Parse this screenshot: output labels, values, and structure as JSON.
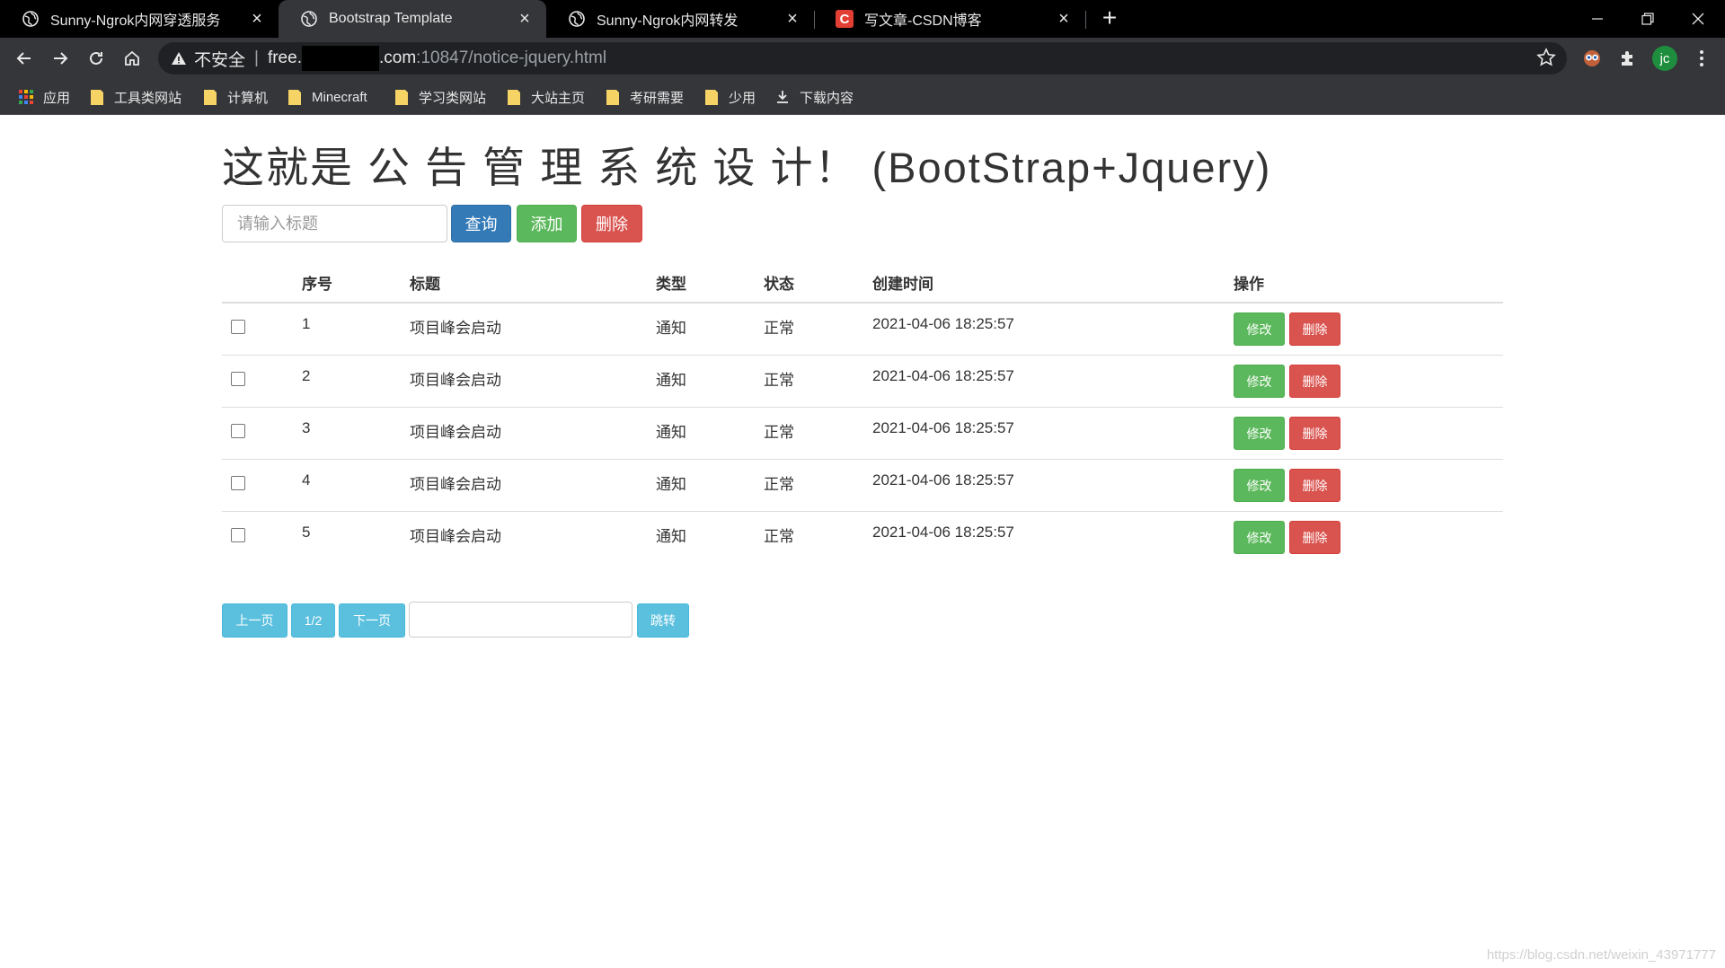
{
  "browser": {
    "tabs": [
      {
        "title": "Sunny-Ngrok内网穿透服务",
        "icon": "globe-icon",
        "active": false
      },
      {
        "title": "Bootstrap Template",
        "icon": "globe-icon",
        "active": true
      },
      {
        "title": "Sunny-Ngrok内网转发",
        "icon": "globe-icon",
        "active": false
      },
      {
        "title": "写文章-CSDN博客",
        "icon": "csdn-icon",
        "active": false
      }
    ],
    "address": {
      "security_label": "不安全",
      "host_prefix": "free.",
      "host_suffix": ".com",
      "path": ":10847/notice-jquery.html"
    },
    "profile_initials": "jc",
    "bookmarks": [
      {
        "label": "应用",
        "icon": "apps-grid-icon"
      },
      {
        "label": "工具类网站",
        "icon": "folder-icon"
      },
      {
        "label": "计算机",
        "icon": "folder-icon"
      },
      {
        "label": "Minecraft",
        "icon": "folder-icon"
      },
      {
        "label": "学习类网站",
        "icon": "folder-icon"
      },
      {
        "label": "大站主页",
        "icon": "folder-icon"
      },
      {
        "label": "考研需要",
        "icon": "folder-icon"
      },
      {
        "label": "少用",
        "icon": "folder-icon"
      },
      {
        "label": "下载内容",
        "icon": "download-icon"
      }
    ]
  },
  "page": {
    "title": "这就是 公 告 管 理 系 统 设 计！ (BootStrap+Jquery)",
    "search_placeholder": "请输入标题",
    "buttons": {
      "query": "查询",
      "add": "添加",
      "delete": "删除"
    },
    "table": {
      "headers": [
        "序号",
        "标题",
        "类型",
        "状态",
        "创建时间",
        "操作"
      ],
      "rows": [
        {
          "id": "1",
          "title": "项目峰会启动",
          "type": "通知",
          "status": "正常",
          "created": "2021-04-06 18:25:57"
        },
        {
          "id": "2",
          "title": "项目峰会启动",
          "type": "通知",
          "status": "正常",
          "created": "2021-04-06 18:25:57"
        },
        {
          "id": "3",
          "title": "项目峰会启动",
          "type": "通知",
          "status": "正常",
          "created": "2021-04-06 18:25:57"
        },
        {
          "id": "4",
          "title": "项目峰会启动",
          "type": "通知",
          "status": "正常",
          "created": "2021-04-06 18:25:57"
        },
        {
          "id": "5",
          "title": "项目峰会启动",
          "type": "通知",
          "status": "正常",
          "created": "2021-04-06 18:25:57"
        }
      ],
      "row_actions": {
        "edit": "修改",
        "delete": "删除"
      }
    },
    "pagination": {
      "prev": "上一页",
      "page": "1/2",
      "next": "下一页",
      "jump": "跳转"
    },
    "watermark": "https://blog.csdn.net/weixin_43971777"
  }
}
